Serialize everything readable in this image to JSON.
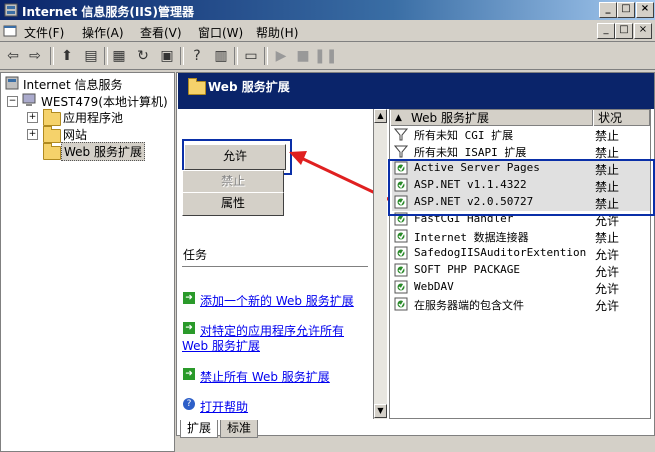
{
  "window": {
    "title": "Internet 信息服务(IIS)管理器",
    "min": "_",
    "max": "□",
    "close": "×"
  },
  "menu": {
    "items": [
      "文件(F)",
      "操作(A)",
      "查看(V)",
      "窗口(W)",
      "帮助(H)"
    ]
  },
  "tree": {
    "root": "Internet 信息服务",
    "computer": "WEST479(本地计算机)",
    "items": [
      "应用程序池",
      "网站",
      "Web 服务扩展"
    ]
  },
  "panel": {
    "title": "Web 服务扩展"
  },
  "buttons": {
    "allow": "允许",
    "deny": "禁止",
    "properties": "属性"
  },
  "tasks": {
    "title": "任务",
    "add_new": "添加一个新的 Web 服务扩展",
    "allow_specific_1": "对特定的应用程序允许所有",
    "allow_specific_2": "Web 服务扩展",
    "deny_all": "禁止所有 Web 服务扩展",
    "help": "打开帮助"
  },
  "list": {
    "headers": {
      "name": "Web 服务扩展",
      "status": "状况"
    },
    "rows": [
      {
        "name": "所有未知 CGI 扩展",
        "status": "禁止"
      },
      {
        "name": "所有未知 ISAPI 扩展",
        "status": "禁止"
      },
      {
        "name": "Active Server Pages",
        "status": "禁止"
      },
      {
        "name": "ASP.NET v1.1.4322",
        "status": "禁止"
      },
      {
        "name": "ASP.NET v2.0.50727",
        "status": "禁止"
      },
      {
        "name": "FastCGI Handler",
        "status": "允许"
      },
      {
        "name": "Internet 数据连接器",
        "status": "禁止"
      },
      {
        "name": "SafedogIISAuditorExtention",
        "status": "允许"
      },
      {
        "name": "SOFT PHP PACKAGE",
        "status": "允许"
      },
      {
        "name": "WebDAV",
        "status": "允许"
      },
      {
        "name": "在服务器端的包含文件",
        "status": "允许"
      }
    ]
  },
  "tabs": [
    "扩展",
    "标准"
  ],
  "colors": {
    "highlight": "#0a2fa8",
    "annotation_arrow": "#e02020",
    "banner": "#0a246a"
  }
}
